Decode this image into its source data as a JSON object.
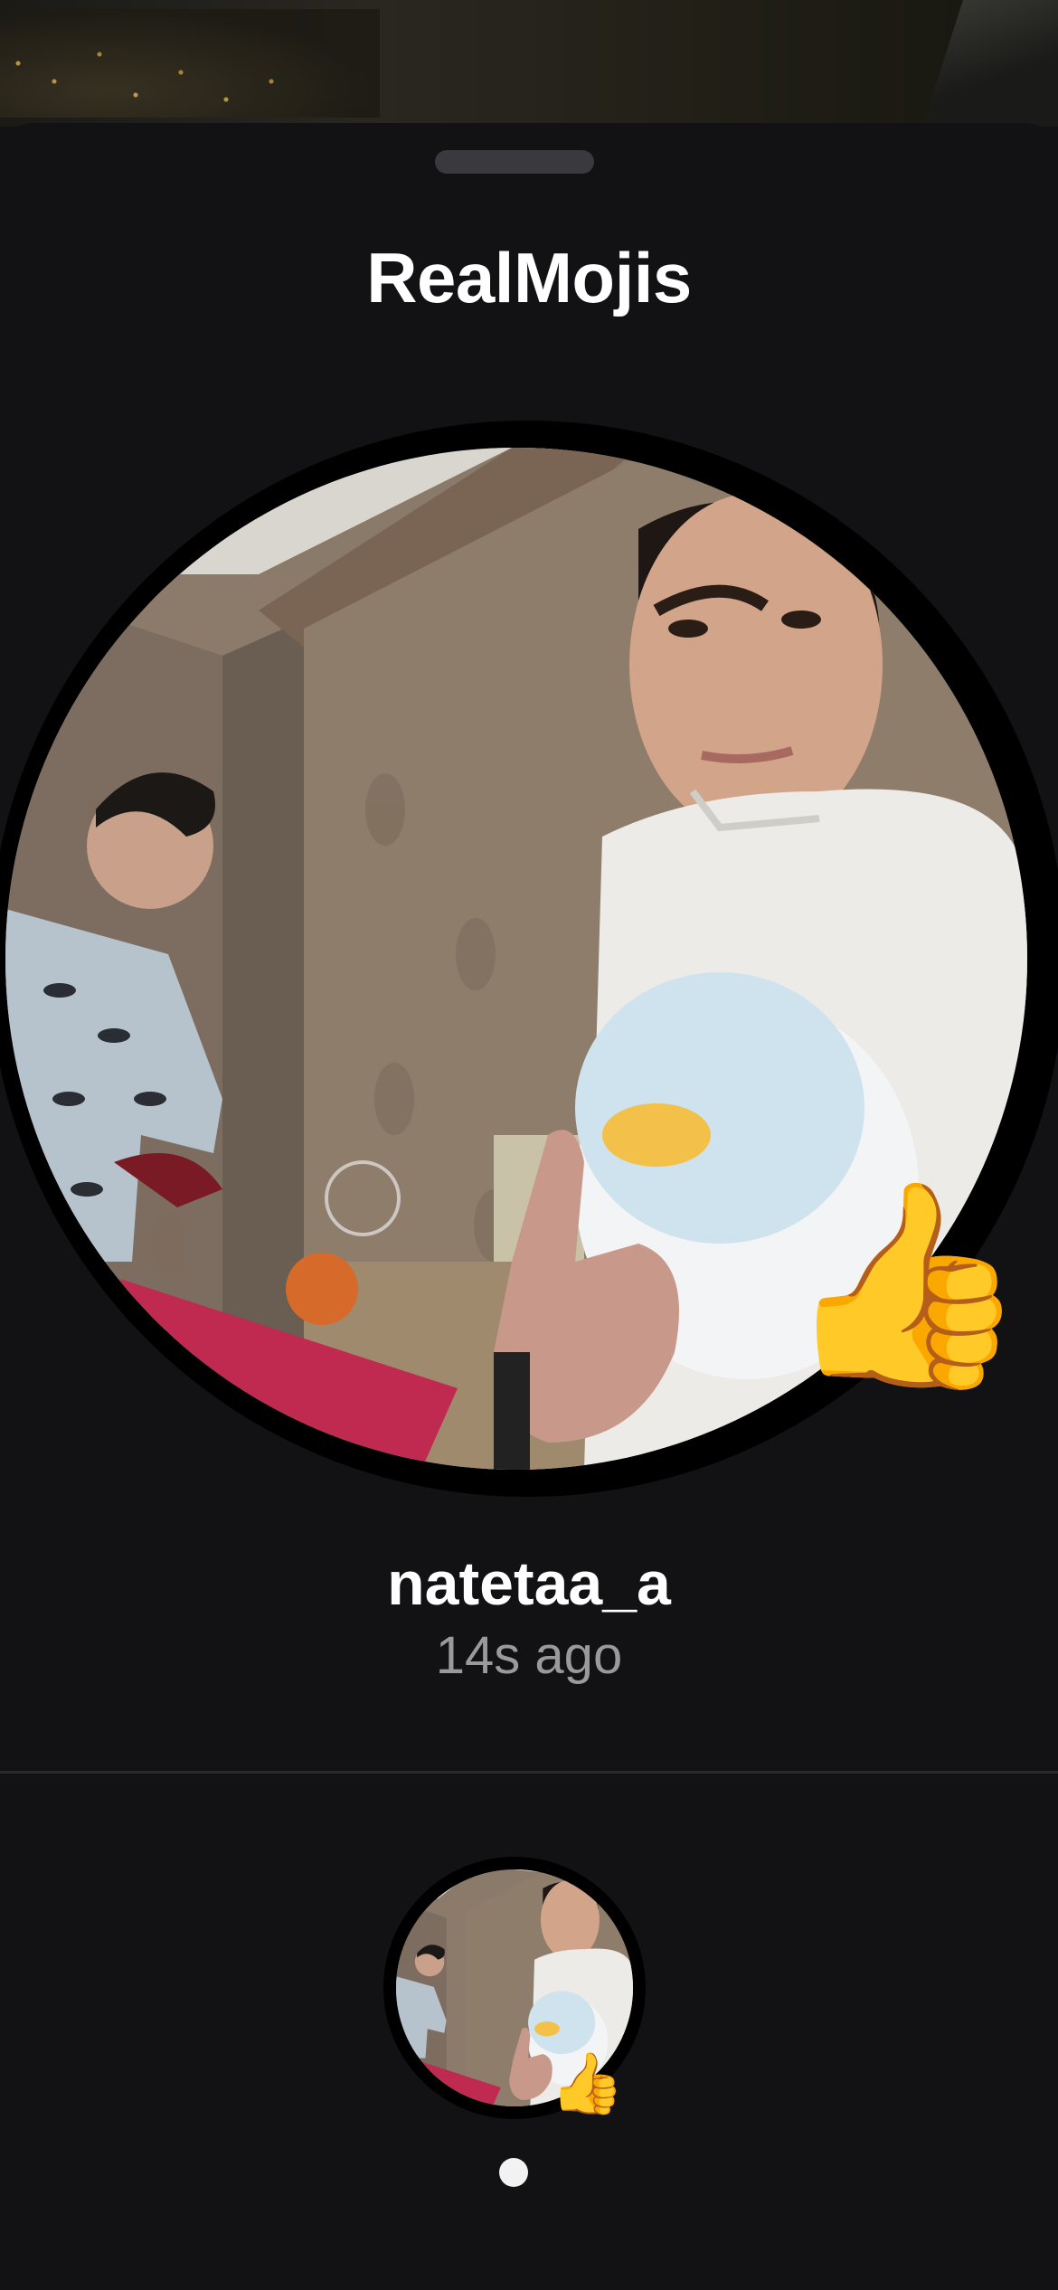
{
  "sheet": {
    "title": "RealMojis"
  },
  "reaction": {
    "emoji": "👍",
    "username": "natetaa_a",
    "time_ago": "14s ago",
    "photo_description_icon": "selfie-photo"
  },
  "carousel": {
    "items": [
      {
        "emoji": "👍",
        "icon": "realmoji-thumbnail"
      }
    ],
    "page_count": 1,
    "current_page": 1
  },
  "colors": {
    "background": "#121214",
    "grabber": "#3a3a3e",
    "secondary_text": "#9a9a9e",
    "divider": "#2a2a2e"
  }
}
